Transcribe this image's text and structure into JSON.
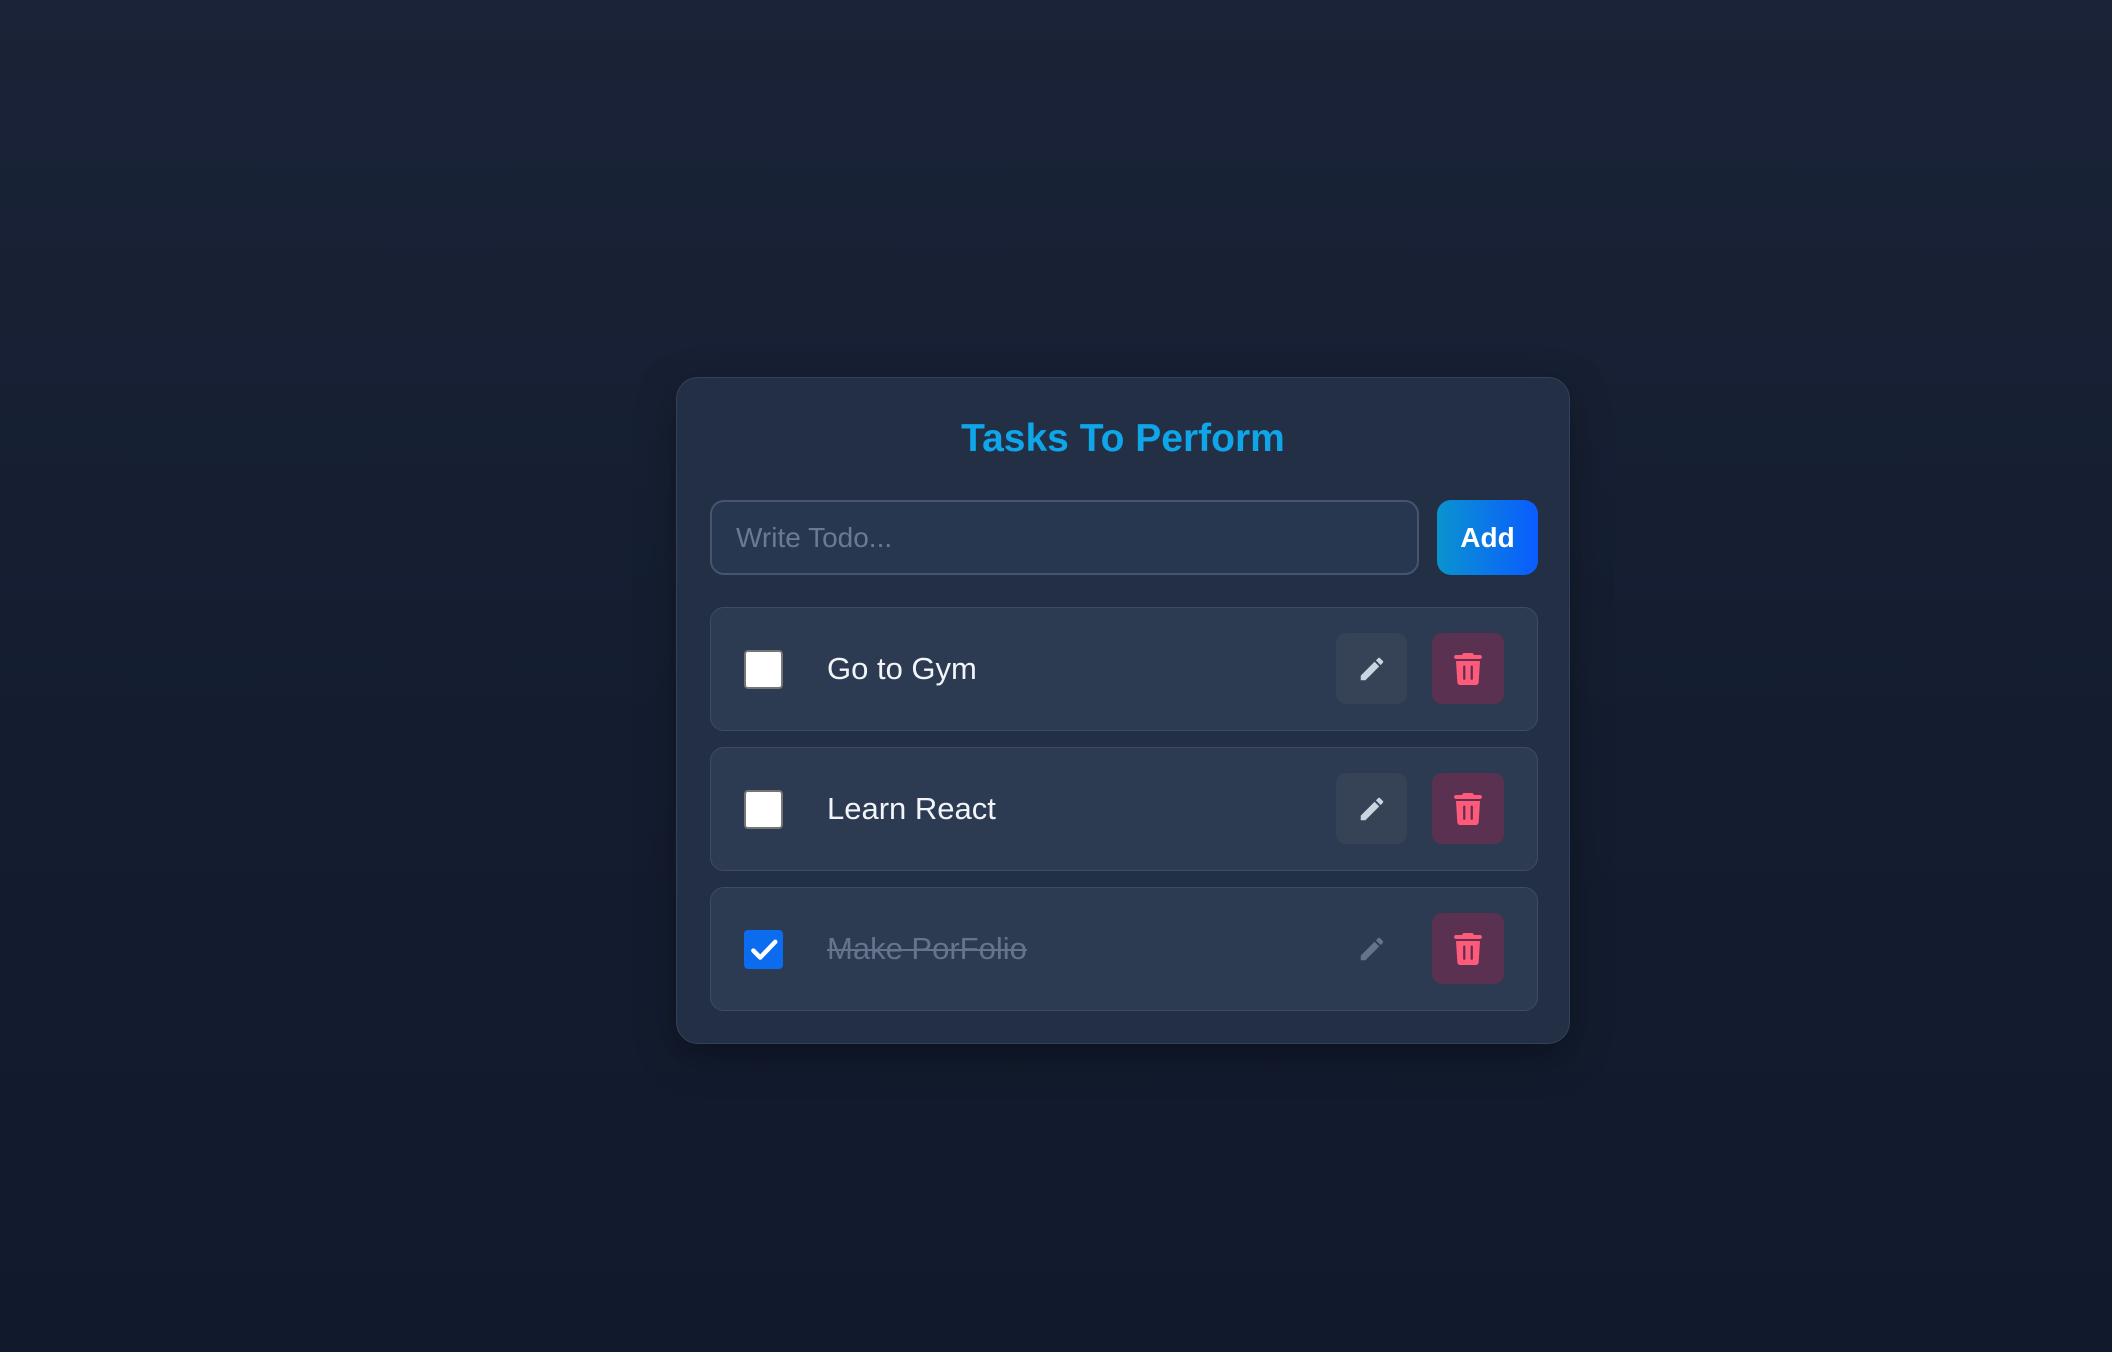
{
  "app": {
    "title": "Tasks To Perform"
  },
  "input": {
    "placeholder": "Write Todo...",
    "value": ""
  },
  "add_button": {
    "label": "Add"
  },
  "todos": [
    {
      "text": "Go to Gym",
      "completed": false
    },
    {
      "text": "Learn React",
      "completed": false
    },
    {
      "text": "Make PorFolio",
      "completed": true
    }
  ],
  "icons": {
    "edit": "pencil-icon",
    "delete": "trash-icon",
    "checked": "checkmark-icon"
  },
  "colors": {
    "title": "#0ea5e9",
    "add_gradient_start": "#0a93cf",
    "add_gradient_end": "#0a5cff",
    "delete_icon": "#ff5a7a",
    "checkbox_checked": "#0b6cf0"
  }
}
